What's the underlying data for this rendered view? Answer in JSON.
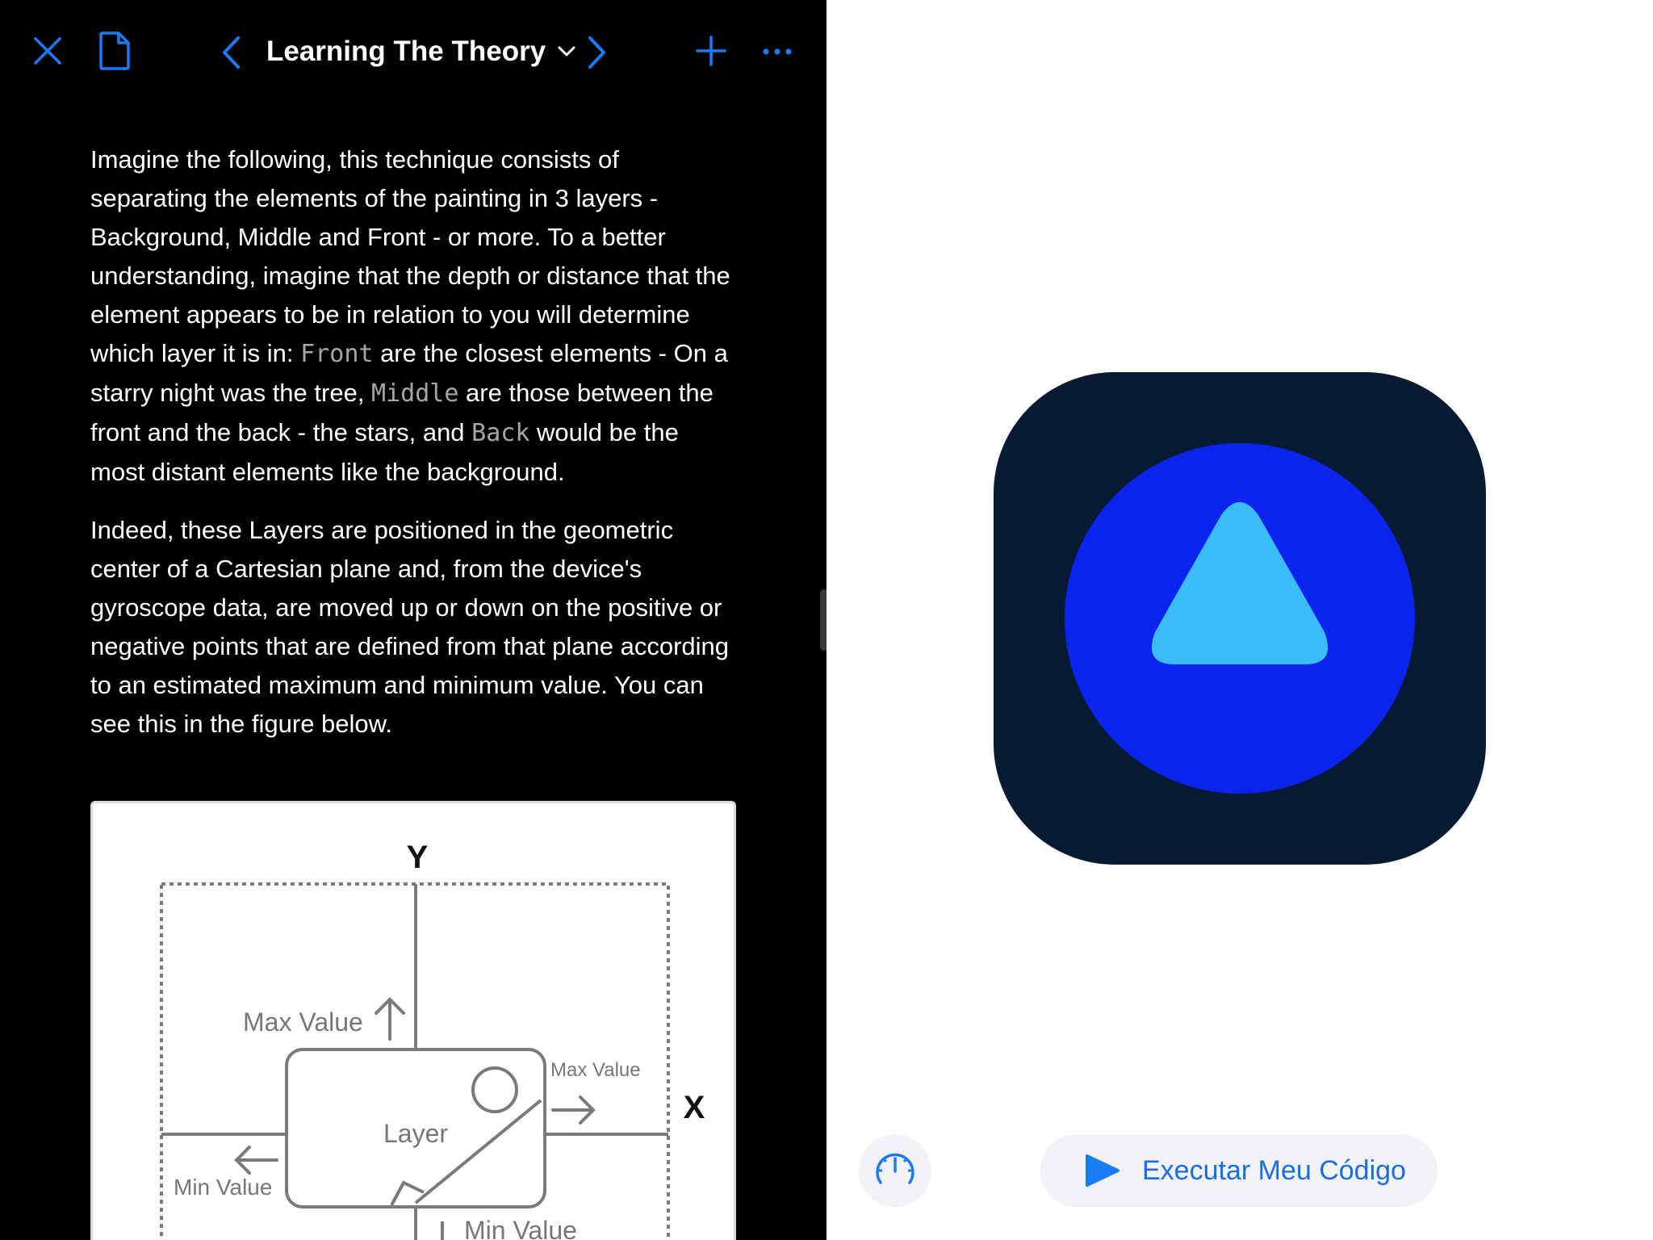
{
  "toolbar": {
    "title": "Learning The Theory"
  },
  "content": {
    "p1": [
      {
        "t": "text",
        "v": "Imagine the following, this technique consists of separating the elements of the painting in 3 layers - Background, Middle and Front - or more. To a better understanding, imagine that the depth or distance that the element appears to be in relation to you will determine which layer it is in: "
      },
      {
        "t": "code",
        "v": "Front"
      },
      {
        "t": "text",
        "v": " are the closest elements - On a starry night was the tree, "
      },
      {
        "t": "code",
        "v": "Middle"
      },
      {
        "t": "text",
        "v": " are those between the front and the back - the stars, and "
      },
      {
        "t": "code",
        "v": "Back"
      },
      {
        "t": "text",
        "v": " would be the most distant elements like the background."
      }
    ],
    "p2": "Indeed, these Layers are positioned in the geometric center of a Cartesian plane and, from the device's gyroscope data, are moved up or down on the positive or negative points that are defined from that plane according to an estimated maximum and minimum value. You can see this in the figure below."
  },
  "figure": {
    "y_axis": "Y",
    "x_axis": "X",
    "layer": "Layer",
    "max_value_y": "Max Value",
    "max_value_x": "Max Value",
    "min_value_x": "Min Value",
    "min_value_y": "Min Value"
  },
  "live_view": {
    "run_label": "Executar Meu Código"
  },
  "colors": {
    "accent": "#1a7cf5",
    "icon_bg": "#061a33",
    "circle": "#0a24ee",
    "triangle": "#38bdf8"
  },
  "icons": [
    "close-icon",
    "document-icon",
    "chevron-left-icon",
    "chevron-down-icon",
    "chevron-right-icon",
    "plus-icon",
    "ellipsis-icon",
    "speedometer-icon",
    "play-icon"
  ]
}
